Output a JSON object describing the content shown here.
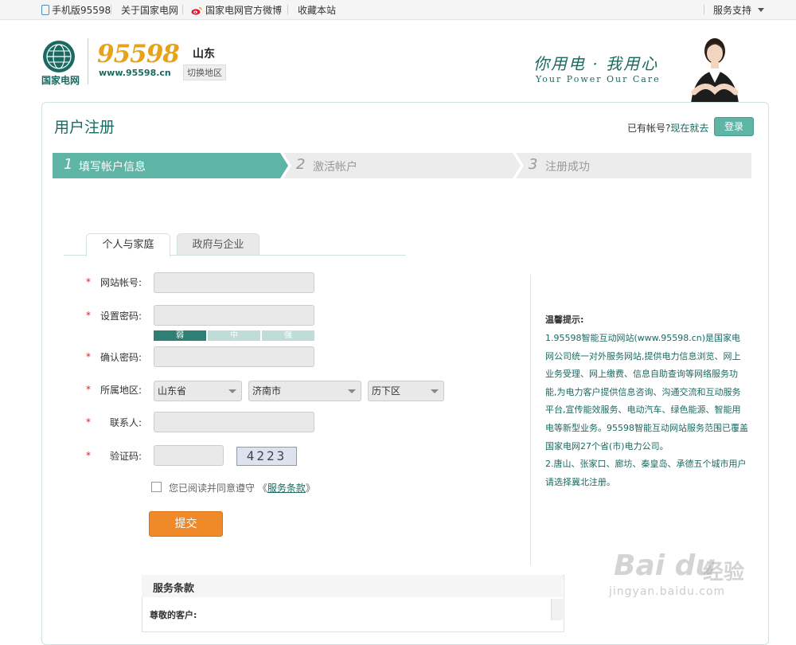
{
  "topbar": {
    "mobile": "手机版95598",
    "about": "关于国家电网",
    "weibo": "国家电网官方微博",
    "favorite": "收藏本站",
    "service": "服务支持"
  },
  "header": {
    "logo_text": "国家电网",
    "brand_number": "95598",
    "brand_url": "www.95598.cn",
    "region": "山东",
    "switch_region": "切换地区",
    "slogan_cn": "你用电 · 我用心",
    "slogan_en": "Your Power  Our Care"
  },
  "page": {
    "title": "用户注册",
    "has_account": "已有帐号?",
    "login_now": "现在就去",
    "login_button": "登录"
  },
  "steps": [
    {
      "num": "1",
      "label": "填写帐户信息",
      "active": true
    },
    {
      "num": "2",
      "label": "激活帐户",
      "active": false
    },
    {
      "num": "3",
      "label": "注册成功",
      "active": false
    }
  ],
  "tabs": {
    "personal": "个人与家庭",
    "business": "政府与企业"
  },
  "form": {
    "required_mark": "*",
    "account_label": "网站帐号:",
    "password_label": "设置密码:",
    "strength": {
      "weak": "弱",
      "medium": "中",
      "strong": "强"
    },
    "confirm_label": "确认密码:",
    "region_label": "所属地区:",
    "province": "山东省",
    "city": "济南市",
    "district": "历下区",
    "contact_label": "联系人:",
    "captcha_label": "验证码:",
    "captcha_text": "4223",
    "agree_text": "您已阅读并同意遵守 《",
    "agree_terms": "服务条款",
    "agree_close": "》",
    "submit": "提交"
  },
  "tips": {
    "title": "温馨提示:",
    "line1": "1.95598智能互动网站(www.95598.cn)是国家电网公司统一对外服务网站,提供电力信息浏览、网上业务受理、网上缴费、信息自助查询等网络服务功能,为电力客户提供信息咨询、沟通交流和互动服务平台,宣传能效服务、电动汽车、绿色能源、智能用电等新型业务。95598智能互动网站服务范围已覆盖国家电网27个省(市)电力公司。",
    "line2": "2.唐山、张家口、廊坊、秦皇岛、承德五个城市用户请选择冀北注册。"
  },
  "terms": {
    "title": "服务条款",
    "greeting": "尊敬的客户:"
  },
  "watermark": {
    "brand": "Bai du",
    "cn": "经验",
    "url": "jingyan.baidu.com"
  },
  "colors": {
    "brand_green": "#1a6a61",
    "step_active": "#5fb5a5",
    "submit_orange": "#f08a28",
    "brand_gold": "#e8a21a"
  }
}
